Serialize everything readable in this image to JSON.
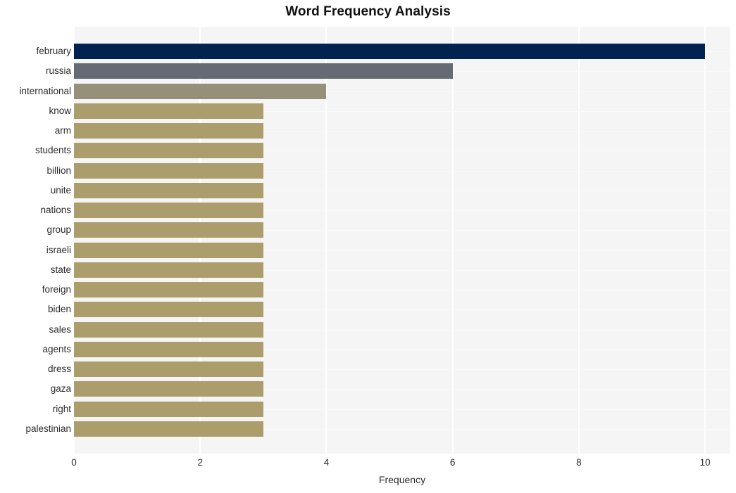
{
  "chart_data": {
    "type": "bar",
    "orientation": "horizontal",
    "title": "Word Frequency Analysis",
    "xlabel": "Frequency",
    "ylabel": "",
    "xlim": [
      0,
      10.4
    ],
    "xticks": [
      0,
      2,
      4,
      6,
      8,
      10
    ],
    "xtick_labels": [
      "0",
      "2",
      "4",
      "6",
      "8",
      "10"
    ],
    "grid": true,
    "grid_axis": "both",
    "legend": "none",
    "style": "whitegrid",
    "categories": [
      "february",
      "russia",
      "international",
      "know",
      "arm",
      "students",
      "billion",
      "unite",
      "nations",
      "group",
      "israeli",
      "state",
      "foreign",
      "biden",
      "sales",
      "agents",
      "dress",
      "gaza",
      "right",
      "palestinian"
    ],
    "values": [
      10,
      6,
      4,
      3,
      3,
      3,
      3,
      3,
      3,
      3,
      3,
      3,
      3,
      3,
      3,
      3,
      3,
      3,
      3,
      3
    ],
    "bar_colors": [
      "#002350",
      "#666a75",
      "#95907a",
      "#ab9e6c",
      "#ab9e6c",
      "#ab9e6c",
      "#ab9e6c",
      "#ab9e6c",
      "#ab9e6c",
      "#ab9e6c",
      "#ab9e6c",
      "#ab9e6c",
      "#ab9e6c",
      "#ab9e6c",
      "#ab9e6c",
      "#ab9e6c",
      "#ab9e6c",
      "#ab9e6c",
      "#ab9e6c",
      "#ab9e6c"
    ]
  },
  "colors": {
    "plot_background": "#f5f5f5",
    "figure_background": "#ffffff",
    "gridline": "#ffffff",
    "text": "#2b2b2b",
    "title_text": "#111111"
  }
}
